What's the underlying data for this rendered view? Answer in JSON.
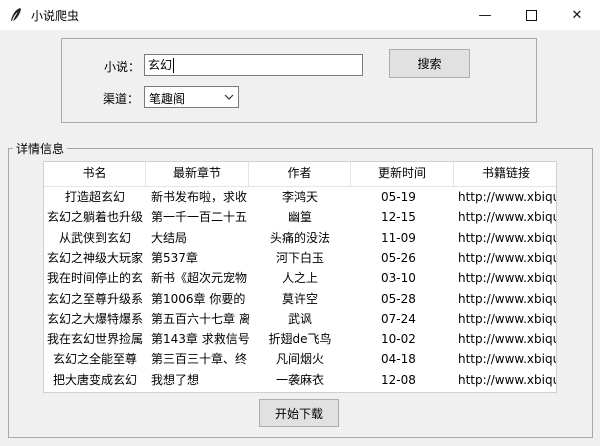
{
  "window": {
    "title": "小说爬虫",
    "minimize_glyph": "—",
    "close_glyph": "✕"
  },
  "search": {
    "novel_label": "小说：",
    "novel_value": "玄幻",
    "search_button": "搜索",
    "channel_label": "渠道：",
    "channel_value": "笔趣阁"
  },
  "details": {
    "legend": "详情信息",
    "columns": [
      "书名",
      "最新章节",
      "作者",
      "更新时间",
      "书籍链接"
    ],
    "rows": [
      [
        "打造超玄幻",
        "新书发布啦，求收",
        "李鸿天",
        "05-19",
        "http://www.xbiqu"
      ],
      [
        "玄幻之躺着也升级",
        "第一千一百二十五",
        "幽篁",
        "12-15",
        "http://www.xbiqu"
      ],
      [
        "从武侠到玄幻",
        "大结局",
        "头痛的没法",
        "11-09",
        "http://www.xbiqu"
      ],
      [
        "玄幻之神级大玩家",
        "第537章",
        "河下白玉",
        "05-26",
        "http://www.xbiqu"
      ],
      [
        "我在时间停止的玄",
        "新书《超次元宠物",
        "人之上",
        "03-10",
        "http://www.xbiqu"
      ],
      [
        "玄幻之至尊升级系",
        "第1006章 你要的",
        "莫许空",
        "05-28",
        "http://www.xbiqu"
      ],
      [
        "玄幻之大爆特爆系",
        "第五百六十七章 离",
        "武讽",
        "07-24",
        "http://www.xbiqu"
      ],
      [
        "我在玄幻世界捡属",
        "第143章 求救信号",
        "折翅de飞鸟",
        "10-02",
        "http://www.xbiqu"
      ],
      [
        "玄幻之全能至尊",
        "第三百三十章、终",
        "凡间烟火",
        "04-18",
        "http://www.xbiqu"
      ],
      [
        "把大唐变成玄幻",
        "我想了想",
        "一袭麻衣",
        "12-08",
        "http://www.xbiqu"
      ]
    ]
  },
  "download_button": "开始下载"
}
